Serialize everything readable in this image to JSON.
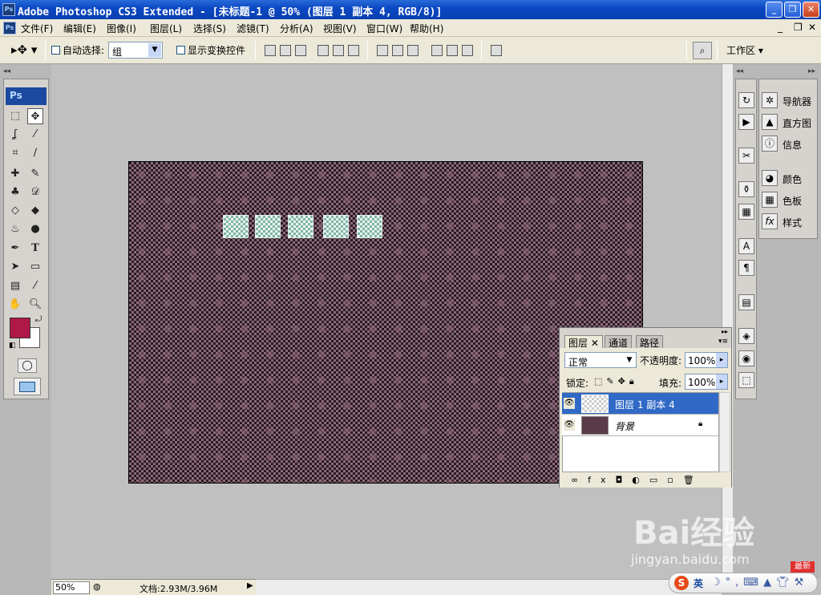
{
  "window": {
    "title": "Adobe Photoshop CS3 Extended - [未标题-1 @ 50% (图层 1 副本 4, RGB/8)]",
    "app_icon": "Ps"
  },
  "menu": [
    "文件(F)",
    "编辑(E)",
    "图像(I)",
    "图层(L)",
    "选择(S)",
    "滤镜(T)",
    "分析(A)",
    "视图(V)",
    "窗口(W)",
    "帮助(H)"
  ],
  "options": {
    "auto_select_label": "自动选择:",
    "auto_select_value": "组",
    "transform_label": "显示变换控件",
    "workspace_label": "工作区 ▾"
  },
  "toolbox": {
    "logo": "Ps",
    "foreground_color": "#b0184a",
    "background_color": "#ffffff"
  },
  "right_panels": [
    {
      "icon": "navigator-icon",
      "label": "导航器"
    },
    {
      "icon": "histogram-icon",
      "label": "直方图"
    },
    {
      "icon": "info-icon",
      "label": "信息"
    },
    {
      "icon": "color-icon",
      "label": "颜色"
    },
    {
      "icon": "swatches-icon",
      "label": "色板"
    },
    {
      "icon": "styles-icon",
      "label": "样式"
    }
  ],
  "layers_panel": {
    "tabs": [
      "图层",
      "通道",
      "路径"
    ],
    "blend_mode": "正常",
    "opacity_label": "不透明度:",
    "opacity_value": "100%",
    "lock_label": "锁定:",
    "fill_label": "填充:",
    "fill_value": "100%",
    "layers": [
      {
        "name": "图层 1 副本 4",
        "selected": true
      },
      {
        "name": "背景",
        "selected": false
      }
    ]
  },
  "status": {
    "zoom": "50%",
    "doc": "文档:2.93M/3.96M"
  },
  "watermark": {
    "brand": "Bai经验",
    "url": "jingyan.baidu.com",
    "badge": "最新"
  },
  "ime": {
    "label": "英"
  }
}
